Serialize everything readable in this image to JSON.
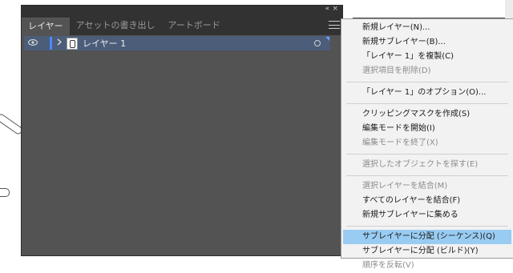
{
  "panel": {
    "tabs": [
      "レイヤー",
      "アセットの書き出し",
      "アートボード"
    ],
    "collapse_glyph": "«",
    "close_glyph": "×",
    "layer": {
      "name": "レイヤー 1",
      "visibility_icon": "eye-icon",
      "expand_icon": "chevron-right-icon",
      "color": "#4f87ff"
    }
  },
  "menu": {
    "items": [
      {
        "label": "新規レイヤー(N)...",
        "enabled": true
      },
      {
        "label": "新規サブレイヤー(B)...",
        "enabled": true
      },
      {
        "label": "「レイヤー 1」を複製(C)",
        "enabled": true
      },
      {
        "label": "選択項目を削除(D)",
        "enabled": false
      },
      {
        "label": "「レイヤー 1」のオプション(O)...",
        "enabled": true
      },
      {
        "label": "クリッピングマスクを作成(S)",
        "enabled": true
      },
      {
        "label": "編集モードを開始(I)",
        "enabled": true
      },
      {
        "label": "編集モードを終了(X)",
        "enabled": false
      },
      {
        "label": "選択したオブジェクトを探す(E)",
        "enabled": false
      },
      {
        "label": "選択レイヤーを結合(M)",
        "enabled": false
      },
      {
        "label": "すべてのレイヤーを結合(F)",
        "enabled": true
      },
      {
        "label": "新規サブレイヤーに集める",
        "enabled": true
      },
      {
        "label": "サブレイヤーに分配 (シーケンス)(Q)",
        "enabled": true,
        "highlighted": true
      },
      {
        "label": "サブレイヤーに分配 (ビルド)(Y)",
        "enabled": true
      },
      {
        "label": "順序を反転(V)",
        "enabled": false
      }
    ]
  },
  "colors": {
    "panel_bg": "#535353",
    "selected_row": "#4b5d79",
    "menu_hover": "#99ccf2"
  }
}
